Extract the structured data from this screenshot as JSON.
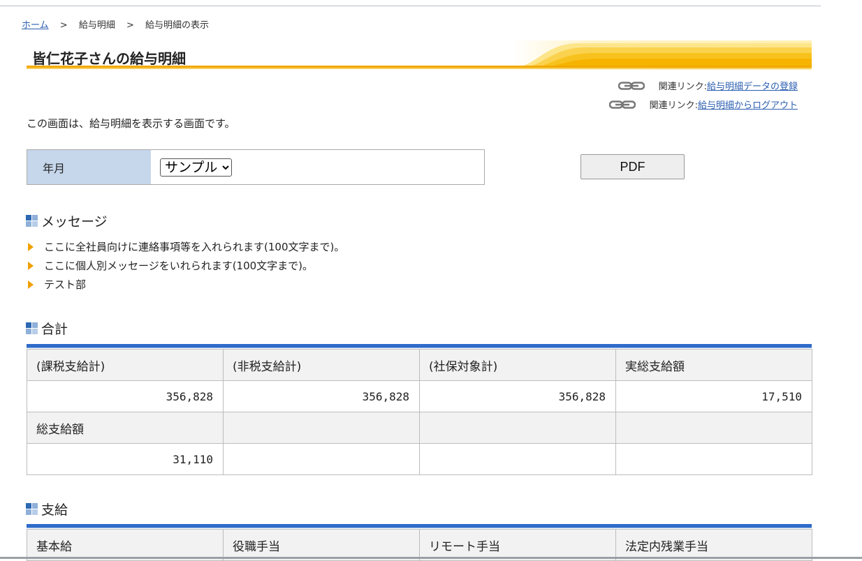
{
  "breadcrumb": {
    "home": "ホーム",
    "sep": ">",
    "level2": "給与明細",
    "current": "給与明細の表示"
  },
  "page_title": "皆仁花子さんの給与明細",
  "related_links": [
    {
      "prefix": "関連リンク:",
      "label": "給与明細データの登録"
    },
    {
      "prefix": "関連リンク:",
      "label": "給与明細からログアウト"
    }
  ],
  "intro": "この画面は、給与明細を表示する画面です。",
  "year_month": {
    "label": "年月",
    "selected": "サンプル"
  },
  "pdf_button": "PDF",
  "messages": {
    "title": "メッセージ",
    "items": [
      "ここに全社員向けに連絡事項等を入れられます(100文字まで)。",
      "ここに個人別メッセージをいれられます(100文字まで)。",
      "テスト部"
    ]
  },
  "totals": {
    "title": "合計",
    "rows": [
      [
        "(課税支給計)",
        "(非税支給計)",
        "(社保対象計)",
        "実総支給額"
      ],
      [
        "356,828",
        "356,828",
        "356,828",
        "17,510"
      ],
      [
        "総支給額",
        "",
        "",
        ""
      ],
      [
        "31,110",
        "",
        "",
        ""
      ]
    ]
  },
  "payments": {
    "title": "支給",
    "rows": [
      [
        "基本給",
        "役職手当",
        "リモート手当",
        "法定内残業手当"
      ]
    ]
  },
  "colors": {
    "accent_blue": "#2f6bc9",
    "header_label_bg": "#c6d7ec",
    "title_stripe": "#f6b400",
    "link": "#2a5db0"
  }
}
